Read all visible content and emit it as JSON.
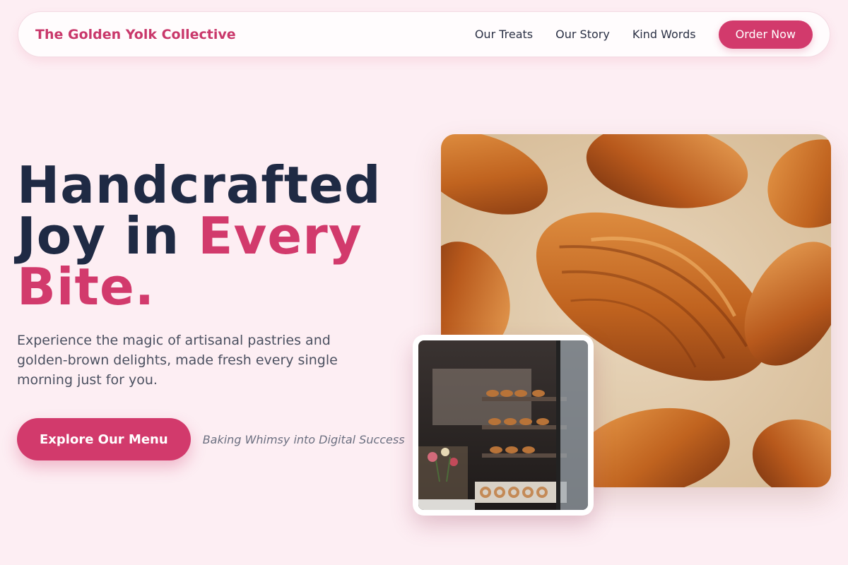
{
  "header": {
    "brand": "The Golden Yolk Collective",
    "nav_links": [
      "Our Treats",
      "Our Story",
      "Kind Words"
    ],
    "cta_label": "Order Now"
  },
  "hero": {
    "headline_line1": "Handcrafted",
    "headline_line2_plain": "Joy in ",
    "headline_line2_accent": "Every",
    "headline_line3_accent": "Bite.",
    "subtext": "Experience the magic of artisanal pastries and golden-brown delights, made fresh every single morning just for you.",
    "cta_label": "Explore Our Menu",
    "tagline": "Baking Whimsy into Digital Success"
  },
  "images": {
    "main_alt": "croissants-photo",
    "secondary_alt": "bakery-display-photo"
  },
  "colors": {
    "accent": "#d23a6c",
    "background": "#fdeef3",
    "heading": "#1f2a44"
  }
}
